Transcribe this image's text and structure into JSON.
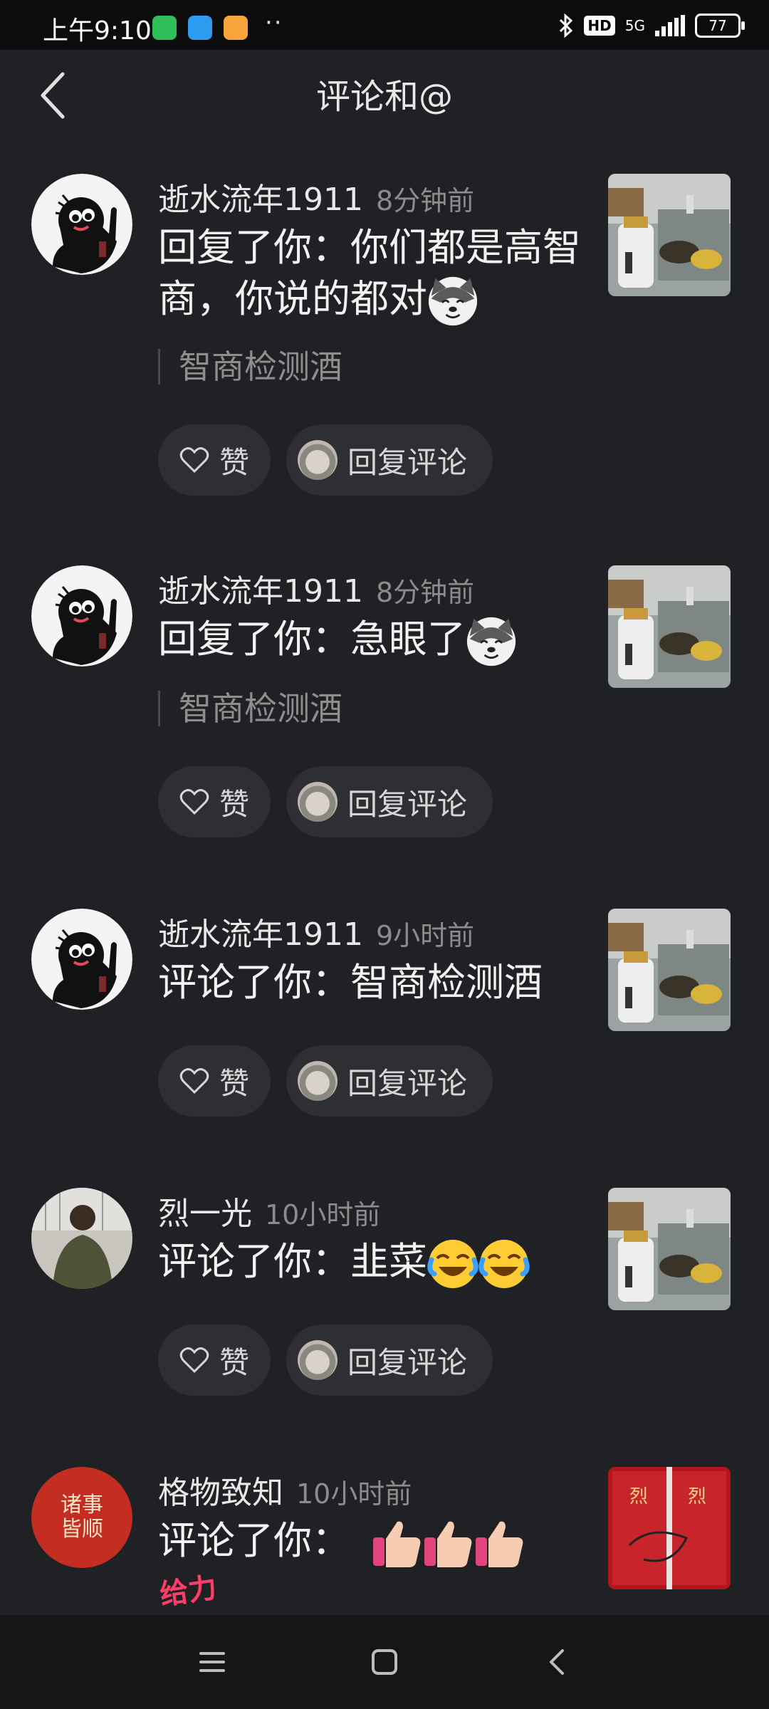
{
  "status_bar": {
    "time": "上午9:10",
    "apps": [
      "wechat-icon",
      "message-icon",
      "notes-icon"
    ],
    "dots": "··",
    "hd": "HD",
    "network": "5G",
    "battery": "77"
  },
  "header": {
    "title": "评论和@"
  },
  "items": [
    {
      "user": "逝水流年1911",
      "time": "8分钟前",
      "text": "回复了你：你们都是高智商，你说的都对",
      "emoji": [
        "husky-emoji"
      ],
      "quote": "智商检测酒",
      "like_label": "赞",
      "reply_label": "回复评论"
    },
    {
      "user": "逝水流年1911",
      "time": "8分钟前",
      "text": "回复了你：急眼了",
      "emoji": [
        "husky-emoji"
      ],
      "quote": "智商检测酒",
      "like_label": "赞",
      "reply_label": "回复评论"
    },
    {
      "user": "逝水流年1911",
      "time": "9小时前",
      "text": "评论了你：智商检测酒",
      "emoji": [],
      "like_label": "赞",
      "reply_label": "回复评论"
    },
    {
      "user": "烈一光",
      "time": "10小时前",
      "text": "评论了你：韭菜",
      "emoji": [
        "laughing-crying-emoji",
        "laughing-crying-emoji"
      ],
      "like_label": "赞",
      "reply_label": "回复评论"
    },
    {
      "user": "格物致知",
      "time": "10小时前",
      "text": "评论了你：",
      "emoji": [
        "thumbs-up-emoji",
        "thumbs-up-emoji",
        "thumbs-up-emoji"
      ],
      "sticker": "给力",
      "avatar_text": "诸事皆顺"
    }
  ],
  "nav": [
    "menu-icon",
    "home-icon",
    "back-icon"
  ],
  "colors": {
    "background": "#202124",
    "button_bg": "#2e2f32",
    "muted_text": "#8c8c8c"
  }
}
